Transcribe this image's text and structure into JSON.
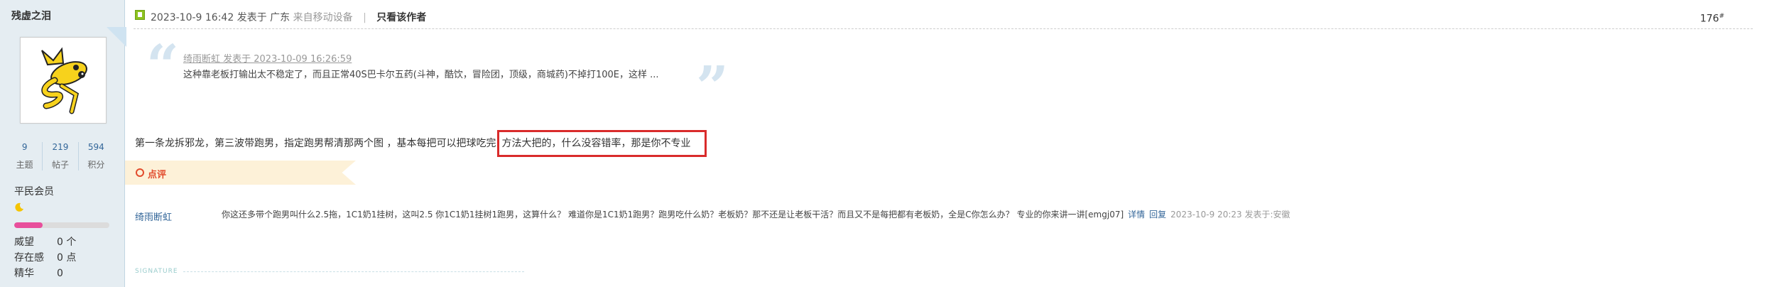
{
  "sidebar": {
    "username": "残虚之泪",
    "stats": [
      {
        "num": "9",
        "label": "主题"
      },
      {
        "num": "219",
        "label": "帖子"
      },
      {
        "num": "594",
        "label": "积分"
      }
    ],
    "group": "平民会员",
    "level_progress": 0.3,
    "props": [
      {
        "key": "威望",
        "value": "0 个"
      },
      {
        "key": "存在感",
        "value": "0 点"
      },
      {
        "key": "精华",
        "value": "0"
      }
    ],
    "accent_color": "#e84f9c"
  },
  "post": {
    "time": "2023-10-9 16:42",
    "posted_in": "发表于 广东",
    "device": "来自移动设备",
    "author_only": "只看该作者",
    "floor": "176",
    "floor_mark": "#"
  },
  "quote": {
    "author": "绮雨断虹 发表于 2023-10-09 16:26:59",
    "text": "这种靠老板打输出太不稳定了，而且正常40S巴卡尔五药(斗神，酷饮，冒险团，顶级，商城药)不掉打100E，这样 ..."
  },
  "message": {
    "text": "第一条龙拆邪龙，第三波带跑男，指定跑男帮清那两个图 ，基本每把可以把球吃完",
    "highlight": "方法大把的，什么没容错率，那是你不专业",
    "highlight_color": "#d92b2b"
  },
  "comment_section": {
    "label": "点评",
    "items": [
      {
        "author": "绮雨断虹",
        "text": "你这还多带个跑男叫什么2.5拖，1C1奶1挂树，这叫2.5 你1C1奶1挂树1跑男，这算什么？ 难道你是1C1奶1跑男？跑男吃什么奶？老板奶？那不还是让老板干活？而且又不是每把都有老板奶，全是C你怎么办？ 专业的你来讲一讲[emgj07]",
        "detail": "详情",
        "reply": "回复",
        "meta": "2023-10-9 20:23 发表于:安徽"
      }
    ]
  },
  "signature": {
    "label": "SIGNATURE"
  }
}
